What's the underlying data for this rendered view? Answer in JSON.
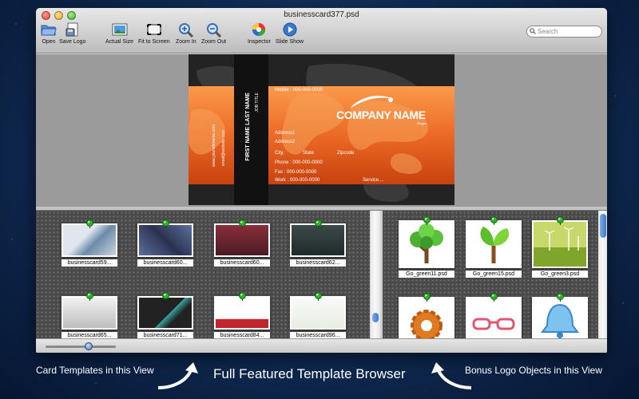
{
  "window": {
    "title": "businesscard377.psd"
  },
  "toolbar": {
    "open": "Open",
    "save_logo": "Save Logo",
    "actual_size": "Actual Size",
    "fit_to_screen": "Fit to Screen",
    "zoom_in": "Zoom In",
    "zoom_out": "Zoom Out",
    "inspector": "Inspector",
    "slide_show": "Slide Show"
  },
  "search": {
    "placeholder": "Search"
  },
  "card": {
    "name": "FIRST NAME LAST NAME",
    "job_title": "JOB TITLE",
    "website": "www.yoursitename.com",
    "email": "email@website.com",
    "mobile": "Mobile  : 000-000-0000",
    "company": "COMPANY NAME",
    "slogan": "Slogan",
    "address1": "Address1",
    "address2": "Address2",
    "city": "City,",
    "state": "State",
    "zipcode": "Zipcode",
    "phone": "Phone     : 000-000-0000",
    "fax": "Fax         : 000-000-0000",
    "work": "Work       : 000-000-0000",
    "service": "Service...."
  },
  "templates": [
    {
      "label": "businesscard59..."
    },
    {
      "label": "businesscard60..."
    },
    {
      "label": "businesscard60..."
    },
    {
      "label": "businesscard62..."
    },
    {
      "label": "businesscard65..."
    },
    {
      "label": "businesscard71..."
    },
    {
      "label": "businesscard84..."
    },
    {
      "label": "businesscard96..."
    }
  ],
  "logos": [
    {
      "label": "Go_green11.psd"
    },
    {
      "label": "Go_green15.psd"
    },
    {
      "label": "Go_green3.psd"
    }
  ],
  "captions": {
    "left": "Card Templates in this View",
    "middle": "Full Featured  Template Browser",
    "right": "Bonus Logo Objects in this View"
  },
  "colors": {
    "card_orange": "#ec6a26",
    "pin_green": "#2fae2a",
    "accent_blue": "#3b78d0"
  }
}
